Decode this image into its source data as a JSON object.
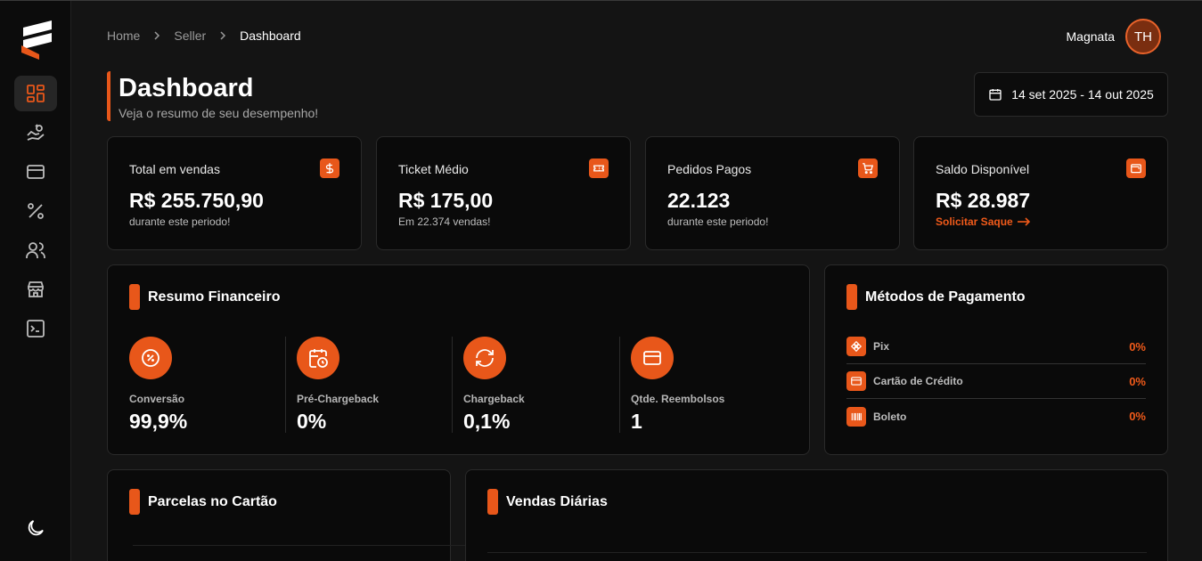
{
  "breadcrumb": {
    "home": "Home",
    "seller": "Seller",
    "current": "Dashboard"
  },
  "user": {
    "name": "Magnata",
    "initials": "TH"
  },
  "page": {
    "title": "Dashboard",
    "subtitle": "Veja o resumo de seu desempenho!"
  },
  "date_range": "14 set 2025 - 14 out 2025",
  "stats": [
    {
      "label": "Total em vendas",
      "value": "R$ 255.750,90",
      "sub": "durante este periodo!",
      "icon": "dollar-icon"
    },
    {
      "label": "Ticket Médio",
      "value": "R$ 175,00",
      "sub": "Em 22.374 vendas!",
      "icon": "ticket-icon"
    },
    {
      "label": "Pedidos Pagos",
      "value": "22.123",
      "sub": "durante este periodo!",
      "icon": "cart-icon"
    },
    {
      "label": "Saldo Disponível",
      "value": "R$ 28.987",
      "sub": "Solicitar Saque",
      "icon": "wallet-icon"
    }
  ],
  "financeiro": {
    "title": "Resumo Financeiro",
    "metrics": [
      {
        "label": "Conversão",
        "value": "99,9%",
        "icon": "percent-circle-icon"
      },
      {
        "label": "Pré-Chargeback",
        "value": "0%",
        "icon": "calendar-clock-icon"
      },
      {
        "label": "Chargeback",
        "value": "0,1%",
        "icon": "refresh-icon"
      },
      {
        "label": "Qtde. Reembolsos",
        "value": "1",
        "icon": "credit-card-icon"
      }
    ]
  },
  "pagamento": {
    "title": "Métodos de Pagamento",
    "methods": [
      {
        "name": "Pix",
        "pct": "0%",
        "icon": "pix-icon"
      },
      {
        "name": "Cartão de Crédito",
        "pct": "0%",
        "icon": "credit-card-icon"
      },
      {
        "name": "Boleto",
        "pct": "0%",
        "icon": "barcode-icon"
      }
    ]
  },
  "parcelas": {
    "title": "Parcelas no Cartão"
  },
  "vendas": {
    "title": "Vendas Diárias"
  },
  "colors": {
    "accent": "#e8571a",
    "background": "#141414",
    "card": "#0a0a0a"
  }
}
